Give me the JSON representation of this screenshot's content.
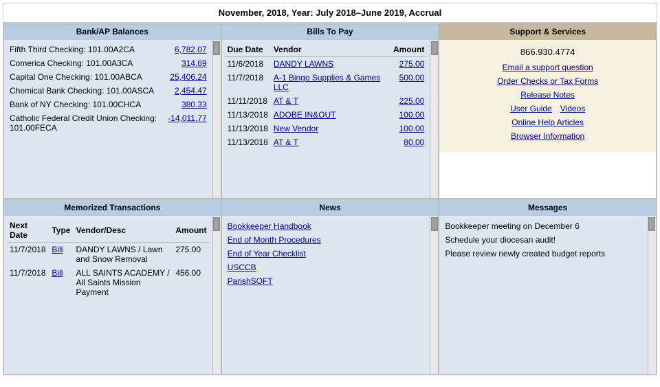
{
  "page": {
    "title": "November, 2018, Year: July 2018–June 2019, Accrual"
  },
  "bank": {
    "header": "Bank/AP Balances",
    "rows": [
      {
        "label": "Fifth Third Checking: 101.00A2CA",
        "amount": "6,782.07",
        "negative": false
      },
      {
        "label": "Comerica Checking: 101.00A3CA",
        "amount": "314.69",
        "negative": false
      },
      {
        "label": "Capital One Checking: 101.00ABCA",
        "amount": "25,406.24",
        "negative": false
      },
      {
        "label": "Chemical Bank Checking: 101.00ASCA",
        "amount": "2,454.47",
        "negative": false
      },
      {
        "label": "Bank of NY Checking: 101.00CHCA",
        "amount": "380.33",
        "negative": false
      },
      {
        "label": "Catholic Federal Credit Union Checking: 101.00FECA",
        "amount": "-14,011.77",
        "negative": true
      }
    ]
  },
  "bills": {
    "header": "Bills To Pay",
    "columns": [
      "Due Date",
      "Vendor",
      "Amount"
    ],
    "rows": [
      {
        "date": "11/6/2018",
        "vendor": "DANDY LAWNS",
        "amount": "275.00"
      },
      {
        "date": "11/7/2018",
        "vendor": "A-1 Bingo Supplies & Games LLC",
        "amount": "500.00"
      },
      {
        "date": "11/11/2018",
        "vendor": "AT & T",
        "amount": "225.00"
      },
      {
        "date": "11/13/2018",
        "vendor": "ADOBE IN&OUT",
        "amount": "100.00"
      },
      {
        "date": "11/13/2018",
        "vendor": "New Vendor",
        "amount": "100.00"
      },
      {
        "date": "11/13/2018",
        "vendor": "AT & T",
        "amount": "80.00"
      }
    ]
  },
  "support": {
    "header": "Support & Services",
    "phone": "866.930.4774",
    "links": [
      "Email a support question",
      "Order Checks or Tax Forms",
      "Release Notes",
      "User Guide",
      "Videos",
      "Online Help Articles",
      "Browser Information"
    ]
  },
  "memo": {
    "header": "Memorized Transactions",
    "columns": [
      "Next Date",
      "Type",
      "Vendor/Desc",
      "Amount"
    ],
    "rows": [
      {
        "date": "11/7/2018",
        "type": "Bill",
        "vendor": "DANDY LAWNS / Lawn and Snow Removal",
        "amount": "275.00"
      },
      {
        "date": "11/7/2018",
        "type": "Bill",
        "vendor": "ALL SAINTS ACADEMY / All Saints Mission Payment",
        "amount": "456.00"
      }
    ]
  },
  "news": {
    "header": "News",
    "links": [
      "Bookkeeper Handbook",
      "End of Month Procedures",
      "End of Year Checklist",
      "USCCB",
      "ParishSOFT"
    ]
  },
  "messages": {
    "header": "Messages",
    "items": [
      "Bookkeeper meeting on December 6",
      "Schedule your diocesan audit!",
      "Please review newly created budget reports"
    ]
  }
}
